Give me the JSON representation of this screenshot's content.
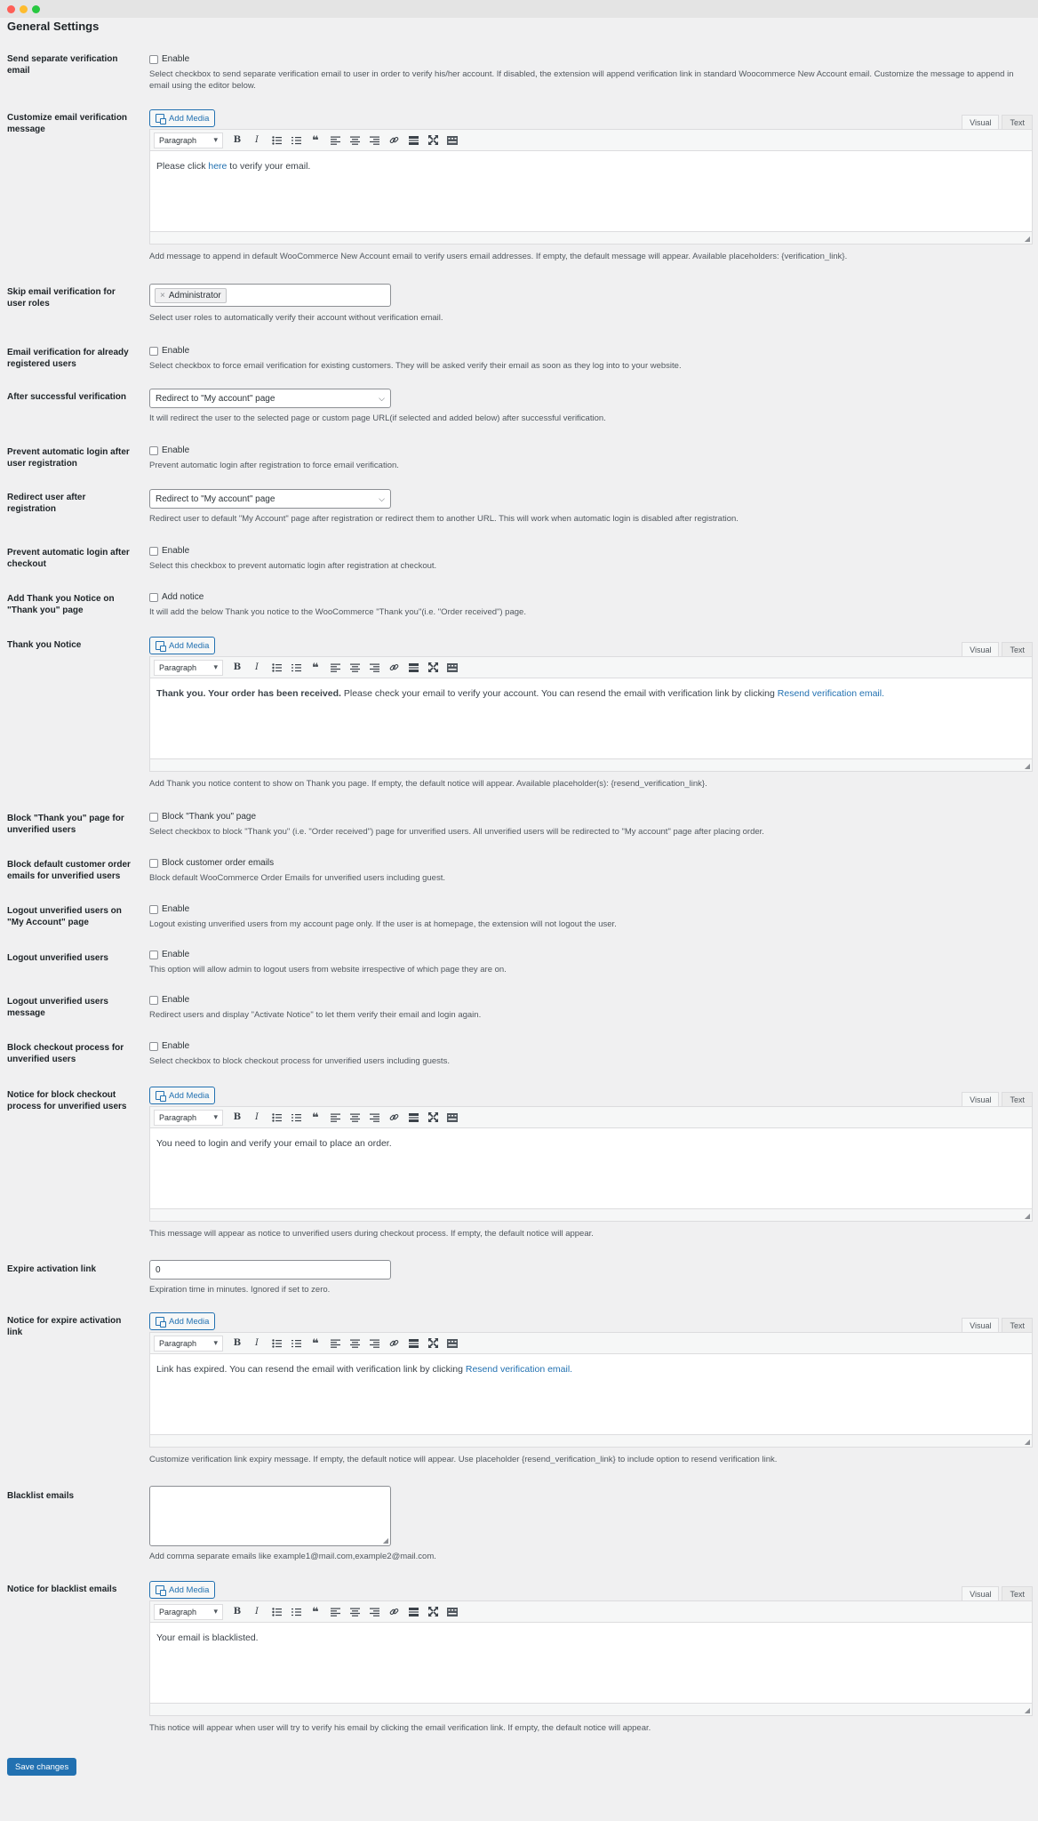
{
  "title": "General Settings",
  "common": {
    "enable": "Enable",
    "add_media": "Add Media",
    "visual": "Visual",
    "text": "Text",
    "paragraph": "Paragraph"
  },
  "sections": {
    "separate_email": {
      "label": "Send separate verification email",
      "checkbox": "Enable",
      "desc": "Select checkbox to send separate verification email to user in order to verify his/her account. If disabled, the extension will append verification link in standard Woocommerce New Account email. Customize the message to append in email using the editor below."
    },
    "customize_message": {
      "label": "Customize email verification message",
      "content_pre": "Please click ",
      "content_link": "here",
      "content_post": " to verify your email.",
      "desc": "Add message to append in default WooCommerce New Account email to verify users email addresses. If empty, the default message will appear. Available placeholders: {verification_link}."
    },
    "skip_roles": {
      "label": "Skip email verification for user roles",
      "tag": "Administrator",
      "desc": "Select user roles to automatically verify their account without verification email."
    },
    "existing_users": {
      "label": "Email verification for already registered users",
      "checkbox": "Enable",
      "desc": "Select checkbox to force email verification for existing customers. They will be asked verify their email as soon as they log into to your website."
    },
    "after_verification": {
      "label": "After successful verification",
      "select": "Redirect to \"My account\" page",
      "desc": "It will redirect the user to the selected page or custom page URL(if selected and added below) after successful verification."
    },
    "prevent_login_reg": {
      "label": "Prevent automatic login after user registration",
      "checkbox": "Enable",
      "desc": "Prevent automatic login after registration to force email verification."
    },
    "redirect_reg": {
      "label": "Redirect user after registration",
      "select": "Redirect to \"My account\" page",
      "desc": "Redirect user to default \"My Account\" page after registration or redirect them to another URL. This will work when automatic login is disabled after registration."
    },
    "prevent_login_checkout": {
      "label": "Prevent automatic login after checkout",
      "checkbox": "Enable",
      "desc": "Select this checkbox to prevent automatic login after registration at checkout."
    },
    "thank_you_notice_toggle": {
      "label": "Add Thank you Notice on \"Thank you\" page",
      "checkbox": "Add notice",
      "desc": "It will add the below Thank you notice to the WooCommerce \"Thank you\"(i.e. \"Order received\") page."
    },
    "thank_you_notice": {
      "label": "Thank you Notice",
      "content_bold": "Thank you. Your order has been received.",
      "content_mid": " Please check your email to verify your account. You can resend the email with verification link by clicking ",
      "content_link": "Resend verification email.",
      "desc": "Add Thank you notice content to show on Thank you page. If empty, the default notice will appear. Available placeholder(s): {resend_verification_link}."
    },
    "block_thank_you": {
      "label": "Block \"Thank you\" page for unverified users",
      "checkbox": "Block \"Thank you\" page",
      "desc": "Select checkbox to block \"Thank you\" (i.e. \"Order received\") page for unverified users. All unverified users will be redirected to \"My account\" page after placing order."
    },
    "block_order_emails": {
      "label": "Block default customer order emails for unverified users",
      "checkbox": "Block customer order emails",
      "desc": "Block default WooCommerce Order Emails for unverified users including guest."
    },
    "logout_my_account": {
      "label": "Logout unverified users on \"My Account\" page",
      "checkbox": "Enable",
      "desc": "Logout existing unverified users from my account page only. If the user is at homepage, the extension will not logout the user."
    },
    "logout_users": {
      "label": "Logout unverified users",
      "checkbox": "Enable",
      "desc": "This option will allow admin to logout users from website irrespective of which page they are on."
    },
    "logout_message": {
      "label": "Logout unverified users message",
      "checkbox": "Enable",
      "desc": "Redirect users and display \"Activate Notice\" to let them verify their email and login again."
    },
    "block_checkout": {
      "label": "Block checkout process for unverified users",
      "checkbox": "Enable",
      "desc": "Select checkbox to block checkout process for unverified users including guests."
    },
    "checkout_notice": {
      "label": "Notice for block checkout process for unverified users",
      "content": "You need to login and verify your email to place an order.",
      "desc": "This message will appear as notice to unverified users during checkout process. If empty, the default notice will appear."
    },
    "expire_link": {
      "label": "Expire activation link",
      "value": "0",
      "desc": "Expiration time in minutes. Ignored if set to zero."
    },
    "expire_notice": {
      "label": "Notice for expire activation link",
      "content_pre": "Link has expired. You can resend the email with verification link by clicking ",
      "content_link": "Resend verification email.",
      "desc": "Customize verification link expiry message. If empty, the default notice will appear. Use placeholder {resend_verification_link} to include option to resend verification link."
    },
    "blacklist": {
      "label": "Blacklist emails",
      "desc": "Add comma separate emails like example1@mail.com,example2@mail.com."
    },
    "blacklist_notice": {
      "label": "Notice for blacklist emails",
      "content": "Your email is blacklisted.",
      "desc": "This notice will appear when user will try to verify his email by clicking the email verification link. If empty, the default notice will appear."
    }
  },
  "save_button": "Save changes"
}
